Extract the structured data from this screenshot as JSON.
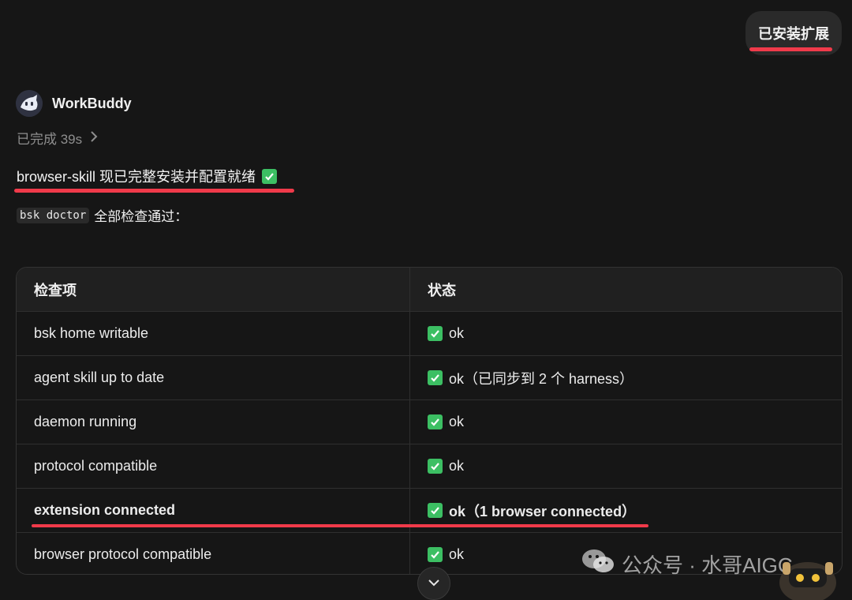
{
  "user_message": {
    "text": "已安装扩展"
  },
  "assistant": {
    "name": "WorkBuddy",
    "status": "已完成 39s"
  },
  "headline": {
    "text": "browser-skill 现已完整安装并配置就绪"
  },
  "doctor": {
    "command": "bsk doctor",
    "suffix": "全部检查通过："
  },
  "table": {
    "headers": [
      "检查项",
      "状态"
    ],
    "rows": [
      {
        "item": "bsk home writable",
        "status": "ok"
      },
      {
        "item": "agent skill up to date",
        "status": "ok（已同步到 2 个 harness）"
      },
      {
        "item": "daemon running",
        "status": "ok"
      },
      {
        "item": "protocol compatible",
        "status": "ok"
      },
      {
        "item": "extension connected",
        "status": "ok（1 browser connected）"
      },
      {
        "item": "browser protocol compatible",
        "status": "ok"
      }
    ]
  },
  "watermark": {
    "text": "公众号 · 水哥AIGC"
  },
  "colors": {
    "accent_red": "#f03a4a",
    "check_green": "#3cbf63"
  },
  "icons": [
    "chevron-right-icon",
    "check-box-icon",
    "chevron-down-icon",
    "wechat-icon"
  ]
}
